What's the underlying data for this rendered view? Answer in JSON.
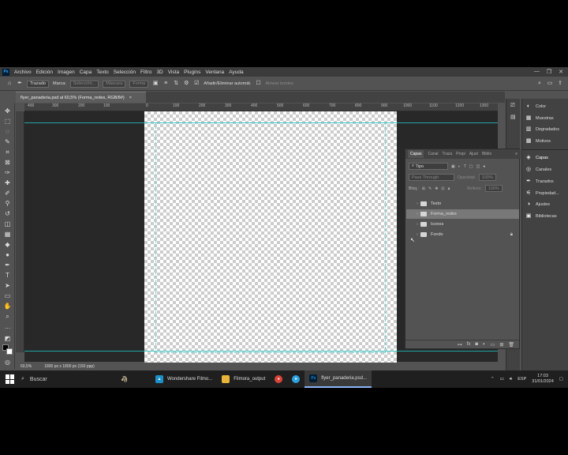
{
  "menu": {
    "items": [
      "Archivo",
      "Edición",
      "Imagen",
      "Capa",
      "Texto",
      "Selección",
      "Filtro",
      "3D",
      "Vista",
      "Plugins",
      "Ventana",
      "Ayuda"
    ],
    "app_logo": "Ps"
  },
  "options": {
    "mode": "Trazado",
    "make_label": "Marca:",
    "selection_btn": "Selección...",
    "mask_btn": "Máscara",
    "shape_btn": "Forma",
    "auto_add_delete": "Añadir/Eliminar automát.",
    "align_edges": "Alinear bordes"
  },
  "document": {
    "tab_title": "flyer_panaderia.psd al 60,5% (Forma_redes, RGB/8#)",
    "close": "×",
    "zoom": "60,5%",
    "size_info": "1800 px x 1800 px (150 ppp)"
  },
  "ruler": {
    "h_ticks": [
      "400",
      "300",
      "200",
      "100",
      "0",
      "100",
      "200",
      "300",
      "400",
      "500",
      "600",
      "700",
      "800",
      "900",
      "1000",
      "1100",
      "1200",
      "1300"
    ]
  },
  "dock": {
    "group1": [
      "Color",
      "Muestras",
      "Degradados",
      "Motivos"
    ],
    "group2": [
      "Capas",
      "Canales",
      "Trazados",
      "Propiedad...",
      "Ajustes",
      "Bibliotecas"
    ]
  },
  "layers_panel": {
    "tabs": [
      "Capas",
      "Canal",
      "Traza",
      "Propi",
      "Ajust",
      "Biblio"
    ],
    "filter_label": "Tipo",
    "blend_mode": "Pass Through",
    "opacity_label": "Opacidad:",
    "opacity_value": "100%",
    "lock_label": "Bloq.:",
    "fill_label": "Relleno:",
    "fill_value": "100%",
    "layers": [
      {
        "name": "Texto",
        "selected": false,
        "locked": false
      },
      {
        "name": "Forma_redes",
        "selected": true,
        "locked": false
      },
      {
        "name": "Iconos",
        "selected": false,
        "locked": false
      },
      {
        "name": "Fondo",
        "selected": false,
        "locked": true
      }
    ]
  },
  "taskbar": {
    "search_placeholder": "Buscar",
    "apps": [
      {
        "label": "Wondershare Filmo...",
        "active": false
      },
      {
        "label": "Filmora_output",
        "active": false
      },
      {
        "label": "",
        "active": false
      },
      {
        "label": "",
        "active": false
      },
      {
        "label": "flyer_panaderia.psd...",
        "active": true
      }
    ],
    "language": "ESP",
    "time": "17:03",
    "date": "31/01/2024"
  },
  "colors": {
    "guide": "#21c3c3",
    "panel": "#535353",
    "panel_dark": "#424242",
    "workspace": "#282828"
  }
}
